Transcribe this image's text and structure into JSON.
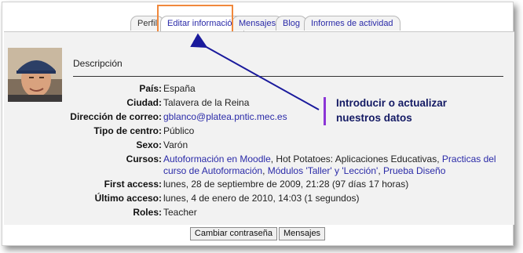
{
  "tabs": [
    {
      "label": "Perfil"
    },
    {
      "label": "Editar información"
    },
    {
      "label": "Mensajes"
    },
    {
      "label": "Blog"
    },
    {
      "label": "Informes de actividad"
    }
  ],
  "section_title": "Descripción",
  "fields": {
    "pais": {
      "label": "País:",
      "value": "España"
    },
    "ciudad": {
      "label": "Ciudad:",
      "value": "Talavera de la Reina"
    },
    "correo": {
      "label": "Dirección de correo:",
      "value": "gblanco@platea.pntic.mec.es"
    },
    "tipo_centro": {
      "label": "Tipo de centro:",
      "value": "Público"
    },
    "sexo": {
      "label": "Sexo:",
      "value": "Varón"
    },
    "cursos": {
      "label": "Cursos:",
      "items": [
        "Autoformación en Moodle",
        "Hot Potatoes: Aplicaciones Educativas",
        "Practicas del curso de Autoformación",
        "Módulos 'Taller' y 'Lección'",
        "Prueba Diseño"
      ]
    },
    "first_access": {
      "label": "First access:",
      "value": "lunes, 28 de septiembre de 2009, 21:28  (97 días 17 horas)"
    },
    "ultimo_acceso": {
      "label": "Último acceso:",
      "value": "lunes, 4 de enero de 2010, 14:03  (1 segundos)"
    },
    "roles": {
      "label": "Roles:",
      "value": "Teacher"
    }
  },
  "callout": {
    "line1": "Introducir o actualizar",
    "line2": "nuestros datos"
  },
  "buttons": {
    "change_password": "Cambiar contraseña",
    "messages": "Mensajes"
  },
  "colors": {
    "highlight": "#f0883c",
    "arrow": "#1a1a9c",
    "callout_bar": "#8b35d6",
    "link": "#2a2aa8"
  }
}
